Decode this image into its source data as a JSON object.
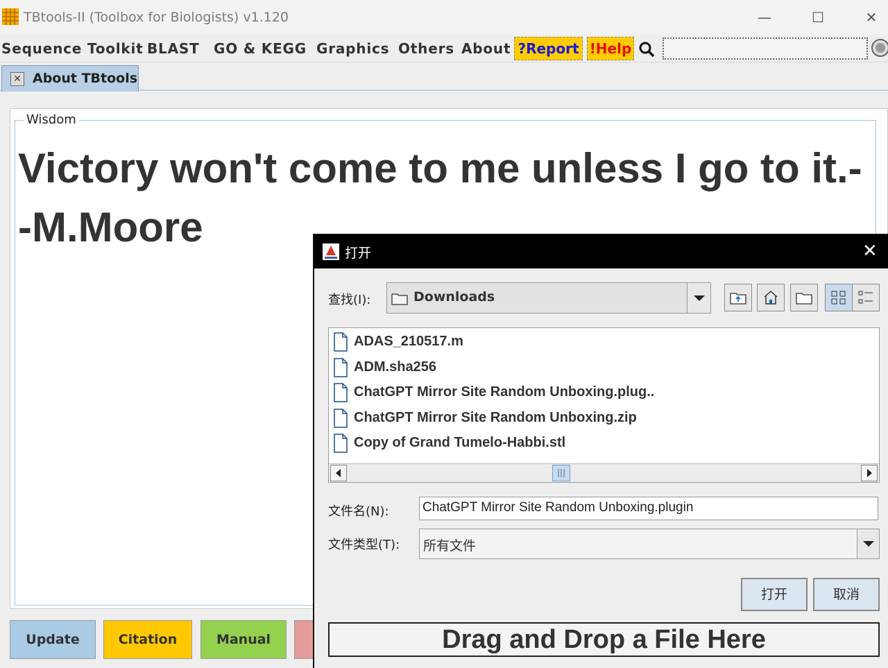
{
  "window": {
    "title": "TBtools-II (Toolbox for Biologists) v1.120",
    "icon": "grid-logo-icon",
    "controls": {
      "minimize": "—",
      "maximize": "☐",
      "close": "✕"
    }
  },
  "menubar": {
    "items": [
      "Sequence Toolkit",
      "BLAST",
      "GO & KEGG",
      "Graphics",
      "Others",
      "About"
    ],
    "report": "?Report",
    "help": "!Help",
    "search_icon": "magnifier-icon"
  },
  "tabs": [
    {
      "label": "About TBtools",
      "close_icon": "✕"
    }
  ],
  "wisdom": {
    "legend": "Wisdom",
    "quote": "Victory won't come to me unless I go to it.--M.Moore"
  },
  "bottom_buttons": [
    {
      "label": "Update",
      "color": "#a9cbe6"
    },
    {
      "label": "Citation",
      "color": "#ffc800"
    },
    {
      "label": "Manual",
      "color": "#93d14f"
    },
    {
      "label": "",
      "color": "#e69a9a"
    }
  ],
  "dialog": {
    "title": "打开",
    "close": "✕",
    "lookin_label": "查找(I):",
    "lookin_value": "Downloads",
    "files": [
      "ADAS_210517.m",
      "ADM.sha256",
      "ChatGPT Mirror Site Random Unboxing.plug..",
      "ChatGPT Mirror Site Random Unboxing.zip",
      "Copy of Grand Tumelo-Habbi.stl"
    ],
    "filename_label": "文件名(N):",
    "filename_value": "ChatGPT Mirror Site Random Unboxing.plugin",
    "filetype_label": "文件类型(T):",
    "filetype_value": "所有文件",
    "open_button": "打开",
    "cancel_button": "取消",
    "dropzone": "Drag and Drop a File Here"
  }
}
